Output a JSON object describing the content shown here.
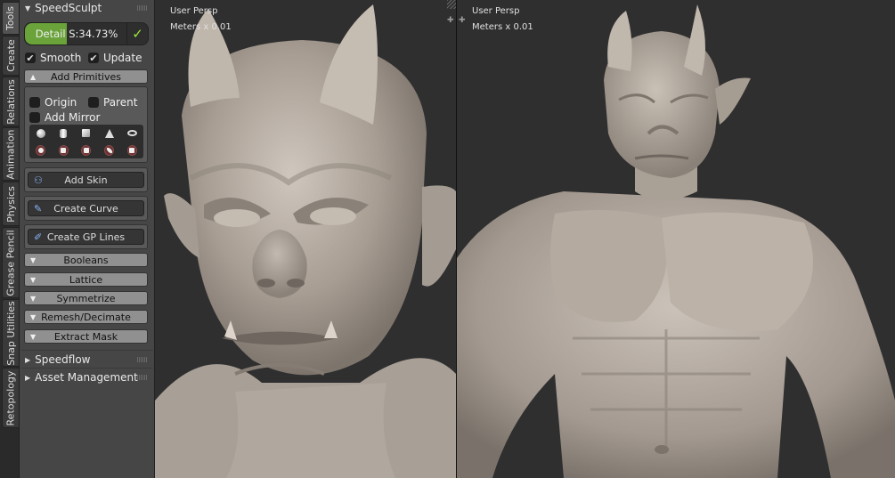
{
  "tabs": [
    {
      "label": "Tools",
      "active": true
    },
    {
      "label": "Create",
      "active": false
    },
    {
      "label": "Relations",
      "active": false
    },
    {
      "label": "Animation",
      "active": false
    },
    {
      "label": "Physics",
      "active": false
    },
    {
      "label": "Grease Pencil",
      "active": false
    },
    {
      "label": "Snap Utilities",
      "active": false
    },
    {
      "label": "Retopology",
      "active": false
    }
  ],
  "panel": {
    "title": "SpeedSculpt",
    "detail": {
      "label": "Detail",
      "value_text": "S:34.73%",
      "fill_fraction": 0.34
    },
    "checks": {
      "smooth": {
        "label": "Smooth",
        "checked": true
      },
      "update": {
        "label": "Update",
        "checked": true
      }
    },
    "add_primitives": {
      "label": "Add Primitives",
      "options": {
        "origin": {
          "label": "Origin",
          "checked": false
        },
        "parent": {
          "label": "Parent",
          "checked": false
        },
        "add_mirror": {
          "label": "Add Mirror",
          "checked": false
        }
      },
      "primitives_row1": [
        "sphere",
        "cylinder",
        "cube",
        "cone",
        "torus"
      ],
      "primitives_row2": [
        "sphere-boolean",
        "cylinder-boolean",
        "cube-boolean",
        "capsule-boolean",
        "plane-boolean"
      ]
    },
    "add_skin": "Add Skin",
    "create_curve": "Create Curve",
    "create_gp_lines": "Create GP Lines",
    "subpanels": [
      "Booleans",
      "Lattice",
      "Symmetrize",
      "Remesh/Decimate",
      "Extract Mask"
    ],
    "sections": [
      {
        "label": "Speedflow"
      },
      {
        "label": "Asset Management"
      }
    ]
  },
  "viewports": {
    "left": {
      "view": "User Persp",
      "units": "Meters x 0.01"
    },
    "right": {
      "view": "User Persp",
      "units": "Meters x 0.01"
    }
  },
  "colors": {
    "accent_green": "#6aa33a",
    "check_green": "#9ae83a",
    "viewport_bg": "#2f2f2f",
    "clay": "#b7ada3"
  }
}
